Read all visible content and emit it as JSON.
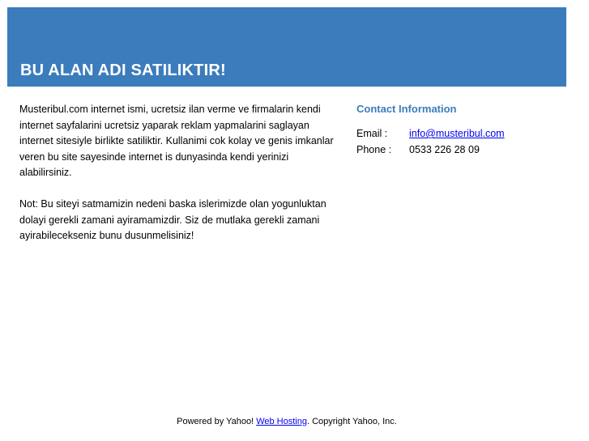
{
  "banner": {
    "title": "BU ALAN ADI SATILIKTIR!",
    "color": "#3a7cbc"
  },
  "main": {
    "paragraph1": "Musteribul.com internet ismi, ucretsiz ilan verme ve firmalarin kendi internet sayfalarini ucretsiz yaparak reklam yapmalarini saglayan internet sitesiyle birlikte satiliktir. Kullanimi cok kolay ve genis imkanlar veren bu site sayesinde internet is dunyasinda kendi yerinizi alabilirsiniz.",
    "paragraph2": "Not: Bu siteyi satmamizin nedeni baska islerimizde olan yogunluktan dolayi gerekli zamani ayiramamizdir. Siz de mutlaka gerekli zamani ayirabilecekseniz bunu dusunmelisiniz!"
  },
  "contact": {
    "heading": "Contact Information",
    "email_label": "Email :",
    "email_value": "info@musteribul.com",
    "phone_label": "Phone :",
    "phone_value": "0533 226 28 09"
  },
  "footer": {
    "prefix": "Powered by Yahoo! ",
    "link_text": "Web Hosting",
    "suffix": ". Copyright Yahoo, Inc."
  }
}
